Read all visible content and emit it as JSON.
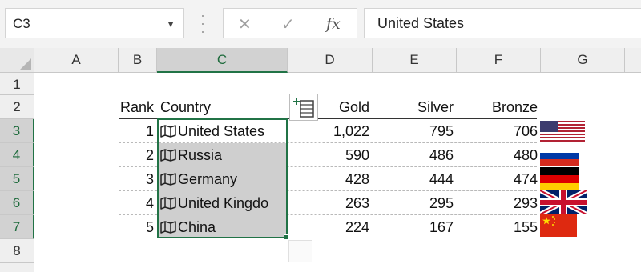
{
  "formula_bar": {
    "name_box": "C3",
    "formula_value": "United States",
    "fx_label": "fx"
  },
  "columns": [
    "A",
    "B",
    "C",
    "D",
    "E",
    "F",
    "G"
  ],
  "rows": [
    "1",
    "2",
    "3",
    "4",
    "5",
    "6",
    "7",
    "8"
  ],
  "table": {
    "headers": {
      "rank": "Rank",
      "country": "Country",
      "gold": "Gold",
      "silver": "Silver",
      "bronze": "Bronze"
    },
    "data": [
      {
        "rank": "1",
        "country": "United States",
        "gold": "1,022",
        "silver": "795",
        "bronze": "706",
        "flag": "flag-usa"
      },
      {
        "rank": "2",
        "country": "Russia",
        "gold": "590",
        "silver": "486",
        "bronze": "480",
        "flag": "flag-russia"
      },
      {
        "rank": "3",
        "country": "Germany",
        "gold": "428",
        "silver": "444",
        "bronze": "474",
        "flag": "flag-germany"
      },
      {
        "rank": "4",
        "country": "United Kingdo",
        "gold": "263",
        "silver": "295",
        "bronze": "293",
        "flag": "flag-uk"
      },
      {
        "rank": "5",
        "country": "China",
        "gold": "224",
        "silver": "167",
        "bronze": "155",
        "flag": "flag-china"
      }
    ]
  },
  "selection": {
    "active_cell": "C3",
    "range": "C3:C7",
    "selected_column": "C"
  },
  "colors": {
    "accent": "#217346",
    "selected_fill": "#cfcfcf",
    "header_fill": "#efefef"
  }
}
